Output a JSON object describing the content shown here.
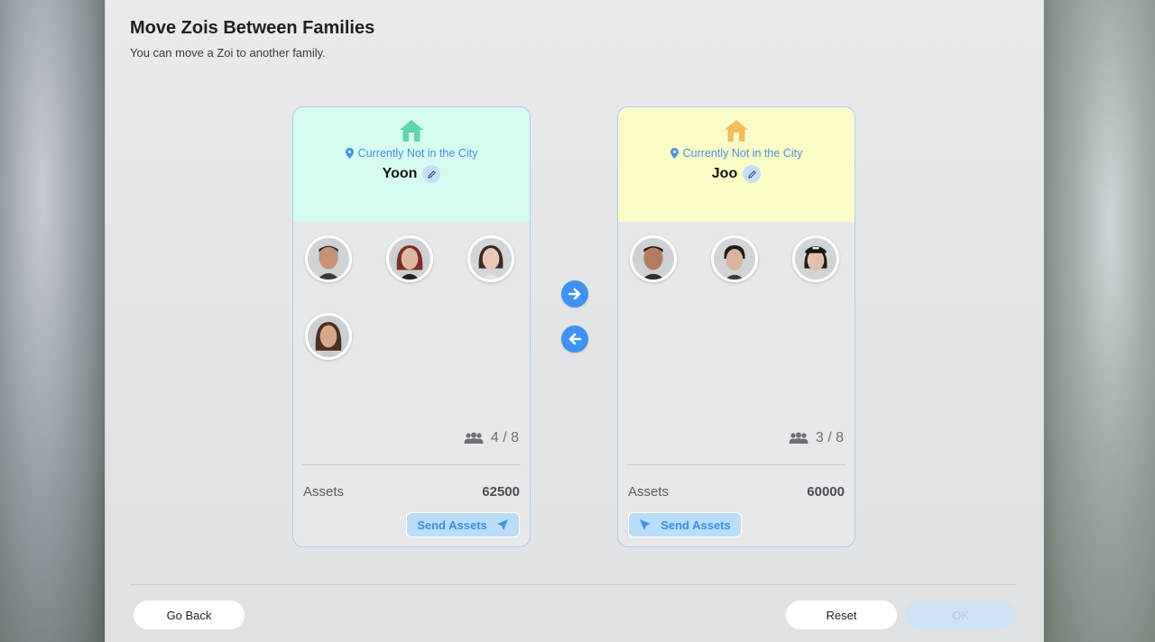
{
  "dialog": {
    "title": "Move Zois Between Families",
    "subtitle": "You can move a Zoi to another family."
  },
  "families": [
    {
      "name": "Yoon",
      "location": "Currently Not in the City",
      "house_color": "#5fd6ad",
      "header_color": "#d6fbf0",
      "member_count": "4 / 8",
      "members": [
        "zoi-1",
        "zoi-2",
        "zoi-3",
        "zoi-4"
      ],
      "assets_label": "Assets",
      "assets_value": "62500",
      "send_label": "Send Assets"
    },
    {
      "name": "Joo",
      "location": "Currently Not in the City",
      "house_color": "#f3bd5a",
      "header_color": "#fcfcc6",
      "member_count": "3 / 8",
      "members": [
        "zoi-5",
        "zoi-6",
        "zoi-7"
      ],
      "assets_label": "Assets",
      "assets_value": "60000",
      "send_label": "Send Assets"
    }
  ],
  "icons": {
    "house": "house-icon",
    "location": "location-pin-icon",
    "edit": "pencil-icon",
    "members": "people-icon",
    "send": "paper-plane-icon",
    "move_right": "arrow-right-icon",
    "move_left": "arrow-left-icon"
  },
  "footer": {
    "back_label": "Go Back",
    "reset_label": "Reset",
    "ok_label": "OK"
  },
  "colors": {
    "accent": "#3f93f0",
    "location_text": "#4a8fe0",
    "card_border": "#a9cdee"
  }
}
